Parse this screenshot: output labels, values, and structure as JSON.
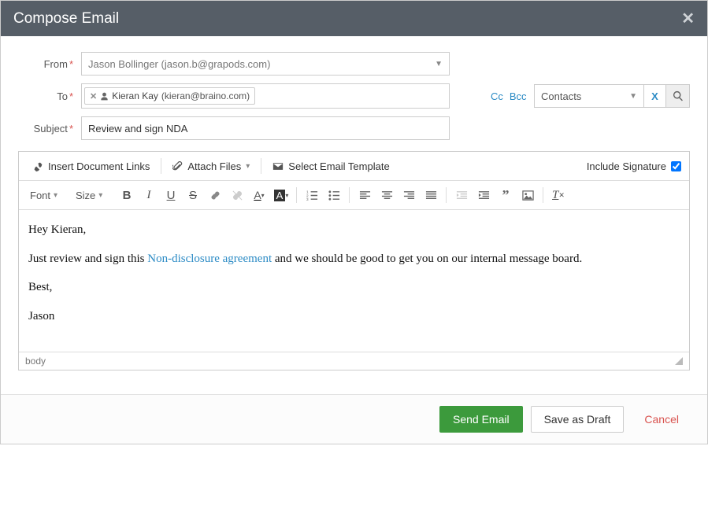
{
  "title": "Compose Email",
  "labels": {
    "from": "From",
    "to": "To",
    "subject": "Subject"
  },
  "from": {
    "name": "Jason Bollinger",
    "email": "(jason.b@grapods.com)"
  },
  "to": {
    "chip_name": "Kieran Kay",
    "chip_email": "(kieran@braino.com)"
  },
  "cc_label": "Cc",
  "bcc_label": "Bcc",
  "contacts_label": "Contacts",
  "clear_label": "X",
  "subject_value": "Review and sign NDA",
  "toolbar": {
    "insert_links": "Insert Document Links",
    "attach_files": "Attach Files",
    "select_template": "Select Email Template",
    "include_signature": "Include Signature",
    "include_signature_checked": true,
    "font_label": "Font",
    "size_label": "Size"
  },
  "body": {
    "greeting": "Hey Kieran,",
    "line_before_link": "Just review and sign this ",
    "link_text": "Non-disclosure agreement",
    "line_after_link": " and we should be good to get you on our internal message board.",
    "closing": "Best,",
    "signature": "Jason"
  },
  "path_bar": "body",
  "buttons": {
    "send": "Send Email",
    "draft": "Save as Draft",
    "cancel": "Cancel"
  }
}
